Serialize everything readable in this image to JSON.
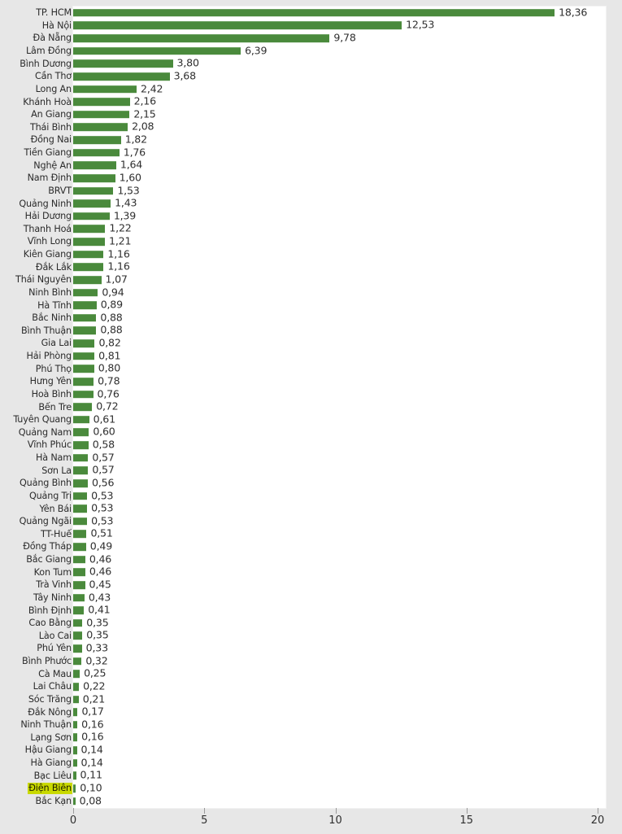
{
  "chart_data": {
    "type": "bar",
    "orientation": "horizontal",
    "title": "",
    "subtitle": "",
    "xlabel": "",
    "ylabel": "",
    "xlim": [
      0,
      20
    ],
    "xticks": [
      0,
      5,
      10,
      15,
      20
    ],
    "xtick_labels": [
      "0",
      "5",
      "10",
      "15",
      "20"
    ],
    "grid": false,
    "legend": null,
    "decimal_separator": ",",
    "bar_color": "#4a8a3c",
    "highlight_color": "#c9d900",
    "plot_background": "#ffffff",
    "figure_background": "#e7e7e7",
    "highlighted_categories": [
      "Điện Biên"
    ],
    "categories": [
      "TP. HCM",
      "Hà Nội",
      "Đà Nẵng",
      "Lâm Đồng",
      "Bình Dương",
      "Cần Thơ",
      "Long An",
      "Khánh Hoà",
      "An Giang",
      "Thái Bình",
      "Đồng Nai",
      "Tiền Giang",
      "Nghệ An",
      "Nam Định",
      "BRVT",
      "Quảng Ninh",
      "Hải Dương",
      "Thanh Hoá",
      "Vĩnh Long",
      "Kiên Giang",
      "Đắk Lắk",
      "Thái Nguyên",
      "Ninh Bình",
      "Hà Tĩnh",
      "Bắc Ninh",
      "Bình Thuận",
      "Gia Lai",
      "Hải Phòng",
      "Phú Thọ",
      "Hưng Yên",
      "Hoà Bình",
      "Bến Tre",
      "Tuyên Quang",
      "Quảng Nam",
      "Vĩnh Phúc",
      "Hà Nam",
      "Sơn La",
      "Quảng Bình",
      "Quảng Trị",
      "Yên Bái",
      "Quảng Ngãi",
      "TT-Huế",
      "Đồng Tháp",
      "Bắc Giang",
      "Kon Tum",
      "Trà Vinh",
      "Tây Ninh",
      "Bình Định",
      "Cao Bằng",
      "Lào Cai",
      "Phú Yên",
      "Bình Phước",
      "Cà Mau",
      "Lai Châu",
      "Sóc Trăng",
      "Đắk Nông",
      "Ninh Thuận",
      "Lạng Sơn",
      "Hậu Giang",
      "Hà Giang",
      "Bạc Liêu",
      "Điện Biên",
      "Bắc Kạn"
    ],
    "values": [
      18.36,
      12.53,
      9.78,
      6.39,
      3.8,
      3.68,
      2.42,
      2.16,
      2.15,
      2.08,
      1.82,
      1.76,
      1.64,
      1.6,
      1.53,
      1.43,
      1.39,
      1.22,
      1.21,
      1.16,
      1.16,
      1.07,
      0.94,
      0.89,
      0.88,
      0.88,
      0.82,
      0.81,
      0.8,
      0.78,
      0.76,
      0.72,
      0.61,
      0.6,
      0.58,
      0.57,
      0.57,
      0.56,
      0.53,
      0.53,
      0.53,
      0.51,
      0.49,
      0.46,
      0.46,
      0.45,
      0.43,
      0.41,
      0.35,
      0.35,
      0.33,
      0.32,
      0.25,
      0.22,
      0.21,
      0.17,
      0.16,
      0.16,
      0.14,
      0.14,
      0.11,
      0.1,
      0.08
    ],
    "value_labels": [
      "18,36",
      "12,53",
      "9,78",
      "6,39",
      "3,80",
      "3,68",
      "2,42",
      "2,16",
      "2,15",
      "2,08",
      "1,82",
      "1,76",
      "1,64",
      "1,60",
      "1,53",
      "1,43",
      "1,39",
      "1,22",
      "1,21",
      "1,16",
      "1,16",
      "1,07",
      "0,94",
      "0,89",
      "0,88",
      "0,88",
      "0,82",
      "0,81",
      "0,80",
      "0,78",
      "0,76",
      "0,72",
      "0,61",
      "0,60",
      "0,58",
      "0,57",
      "0,57",
      "0,56",
      "0,53",
      "0,53",
      "0,53",
      "0,51",
      "0,49",
      "0,46",
      "0,46",
      "0,45",
      "0,43",
      "0,41",
      "0,35",
      "0,35",
      "0,33",
      "0,32",
      "0,25",
      "0,22",
      "0,21",
      "0,17",
      "0,16",
      "0,16",
      "0,14",
      "0,14",
      "0,11",
      "0,10",
      "0,08"
    ]
  }
}
